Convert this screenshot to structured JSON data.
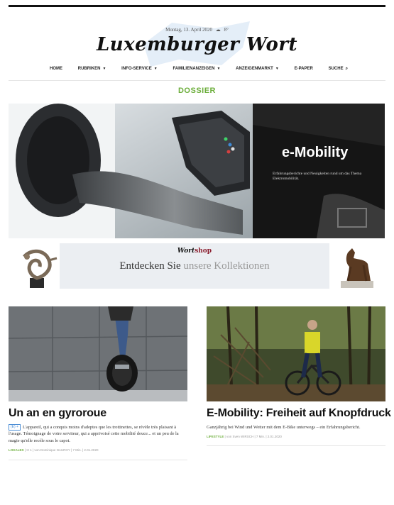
{
  "masthead": {
    "dateline": "Montag, 13. April 2020",
    "temperature": "8°",
    "logo": "Luxemburger Wort"
  },
  "nav": {
    "items": [
      {
        "label": "HOME",
        "has_menu": false
      },
      {
        "label": "RUBRIKEN",
        "has_menu": true
      },
      {
        "label": "INFO-SERVICE",
        "has_menu": true
      },
      {
        "label": "FAMILIENANZEIGEN",
        "has_menu": true
      },
      {
        "label": "ANZEIGENMARKT",
        "has_menu": true
      },
      {
        "label": "E-PAPER",
        "has_menu": false
      },
      {
        "label": "SUCHE",
        "has_menu": false
      }
    ]
  },
  "section_label": "DOSSIER",
  "hero": {
    "title": "e-Mobility",
    "subtitle": "Erfahrungsberichte und Neuigkeiten rund um das Thema Elektromobilität."
  },
  "ad": {
    "brand_prefix": "Wort",
    "brand_suffix": "shop",
    "text_a": "Entdecken Sie ",
    "text_b": "unsere Kollektionen"
  },
  "articles": [
    {
      "title": "Un an en gyroroue",
      "badge": "(E) +",
      "excerpt": "L'appareil, qui a conquis moins d'adeptes que les trottinettes, se révèle très plaisant à l'usage. Témoignage de votre serviteur, qui a apprivoisé cette mobilité douce... et un peu de la magie qu'elle recèle sous le capot.",
      "category": "LOKALES",
      "meta": "|  ✉ 1  |  von Dominique NAUROY  |  7 Min.  |  2.01.2020"
    },
    {
      "title": "E-Mobility: Freiheit auf Knopfdruck",
      "badge": "",
      "excerpt": "Ganzjährig bei Wind und Wetter mit dem E-Bike unterwegs – ein Erfahrungsbericht.",
      "category": "LIFESTYLE",
      "meta": "|  von Sven WIRSCH  |  7 Min.  |  2.01.2020"
    }
  ],
  "colors": {
    "accent_green": "#6cae3b",
    "ad_burgundy": "#8a1d2e",
    "badge_blue": "#4d8fd6"
  }
}
